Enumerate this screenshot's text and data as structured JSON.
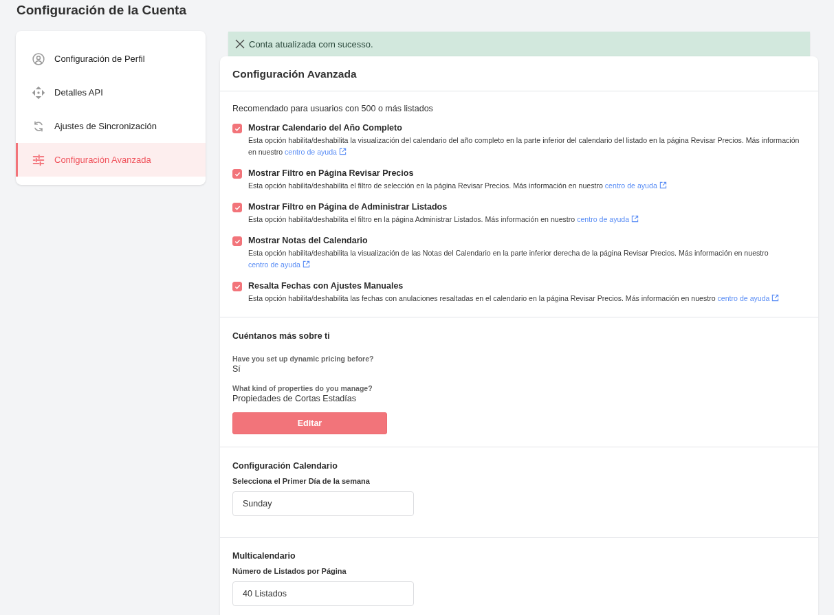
{
  "page_title": "Configuración de la Cuenta",
  "sidebar": {
    "items": [
      {
        "label": "Configuración de Perfil",
        "selected": false
      },
      {
        "label": "Detalles API",
        "selected": false
      },
      {
        "label": "Ajustes de Sincronización",
        "selected": false
      },
      {
        "label": "Configuración Avanzada",
        "selected": true
      }
    ]
  },
  "alert": {
    "message": "Conta atualizada com sucesso."
  },
  "panel": {
    "title": "Configuración Avanzada",
    "advanced": {
      "intro": "Recomendado para usuarios con 500 o más listados",
      "options": [
        {
          "label": "Mostrar Calendario del Año Completo",
          "description": "Esta opción habilita/deshabilita la visualización del calendario del año completo en la parte inferior del calendario del listado en la página Revisar Precios. Más información en nuestro",
          "link": "centro de ayuda",
          "checked": true
        },
        {
          "label": "Mostrar Filtro en Página Revisar Precios",
          "description": "Esta opción habilita/deshabilita el filtro de selección en la página Revisar Precios. Más información en nuestro",
          "link": "centro de ayuda",
          "checked": true
        },
        {
          "label": "Mostrar Filtro en Página de Administrar Listados",
          "description": "Esta opción habilita/deshabilita el filtro en la página Administrar Listados. Más información en nuestro",
          "link": "centro de ayuda",
          "checked": true
        },
        {
          "label": "Mostrar Notas del Calendario",
          "description": "Esta opción habilita/deshabilita la visualización de las Notas del Calendario en la parte inferior derecha de la página Revisar Precios. Más información en nuestro",
          "link": "centro de ayuda",
          "checked": true
        },
        {
          "label": "Resalta Fechas con Ajustes Manuales",
          "description": "Esta opción habilita/deshabilita las fechas con anulaciones resaltadas en el calendario en la página Revisar Precios. Más información en nuestro",
          "link": "centro de ayuda",
          "checked": true
        }
      ]
    },
    "about": {
      "title": "Cuéntanos más sobre ti",
      "answers": [
        {
          "question": "Have you set up dynamic pricing before?",
          "answer": "Sí"
        },
        {
          "question": "What kind of properties do you manage?",
          "answer": "Propiedades de Cortas Estadías"
        }
      ],
      "button": "Editar"
    },
    "calendar": {
      "title": "Configuración Calendario",
      "field_label": "Selecciona el Primer Día de la semana",
      "value": "Sunday"
    },
    "multicalendar": {
      "title": "Multicalendario",
      "field_label": "Número de Listados por Página",
      "value": "40 Listados"
    }
  }
}
